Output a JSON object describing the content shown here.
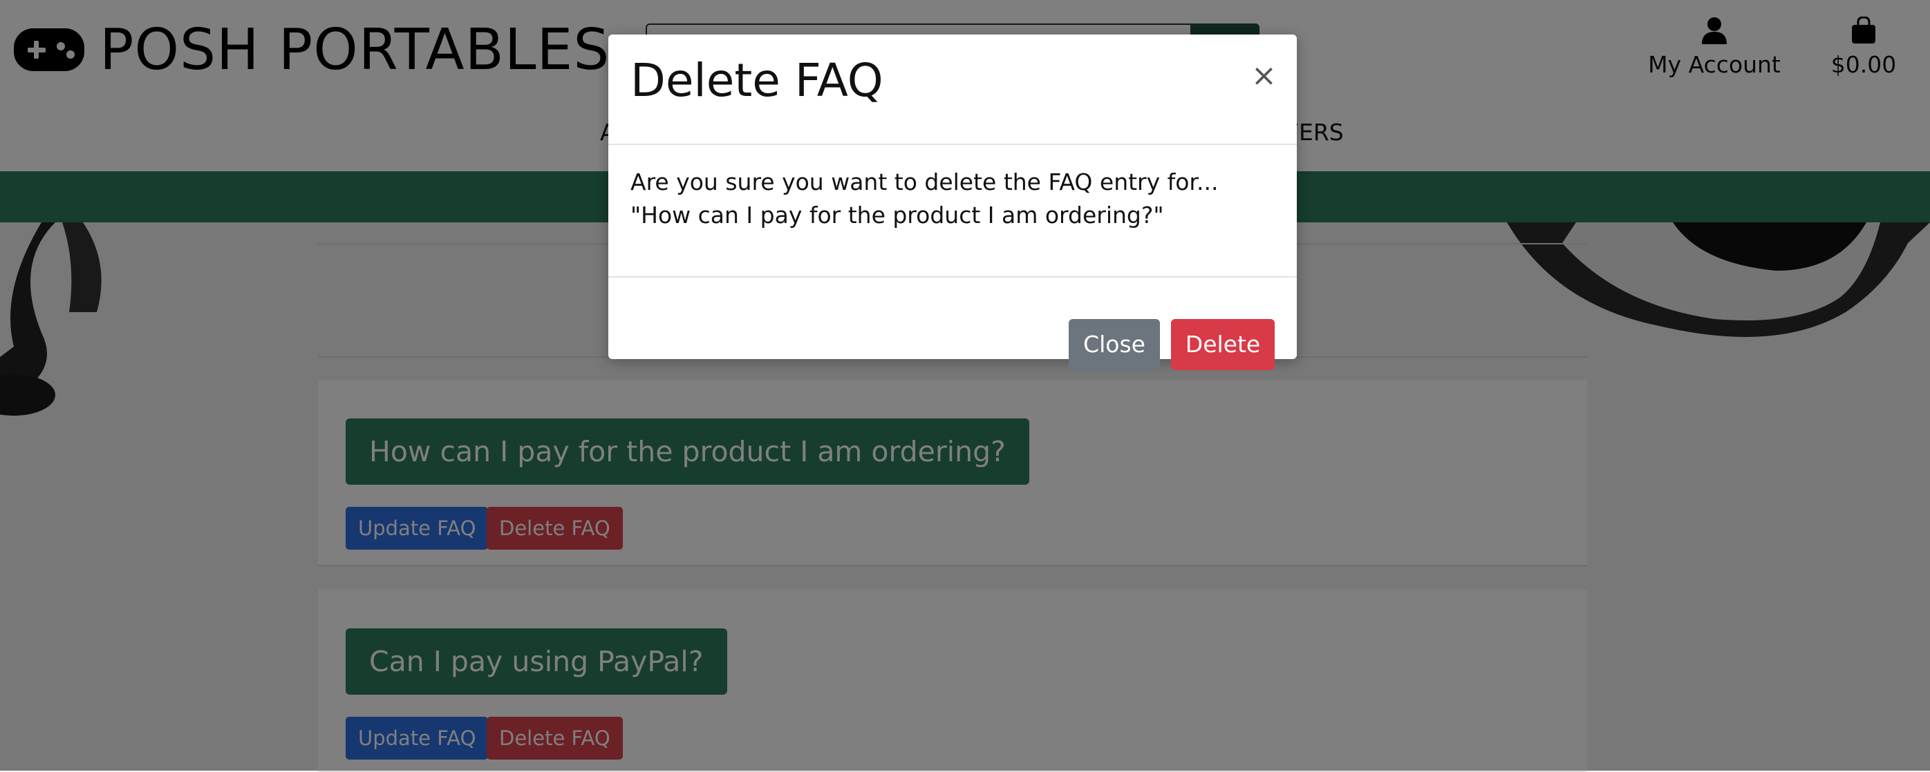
{
  "header": {
    "logo_text": "POSH PORTABLES",
    "account_label": "My Account",
    "bag_total": "$0.00",
    "nav_left_fragment": "A",
    "nav_right_fragment": "FERS"
  },
  "faqs": [
    {
      "question": "How can I pay for the product I am ordering?",
      "update_label": "Update FAQ",
      "delete_label": "Delete FAQ"
    },
    {
      "question": "Can I pay using PayPal?",
      "update_label": "Update FAQ",
      "delete_label": "Delete FAQ"
    }
  ],
  "modal": {
    "title": "Delete FAQ",
    "close_symbol": "×",
    "body": "Are you sure you want to delete the FAQ entry for... \"How can I pay for the product I am ordering?\"",
    "close_label": "Close",
    "delete_label": "Delete"
  },
  "colors": {
    "brand_green": "#2c7a5b",
    "update_blue": "#2e6fe0",
    "delete_red": "#d93a48",
    "close_gray": "#6c757d"
  },
  "icons": {
    "logo": "gamepad-icon",
    "account": "user-icon",
    "bag": "shopping-bag-icon",
    "search": "search-icon"
  }
}
